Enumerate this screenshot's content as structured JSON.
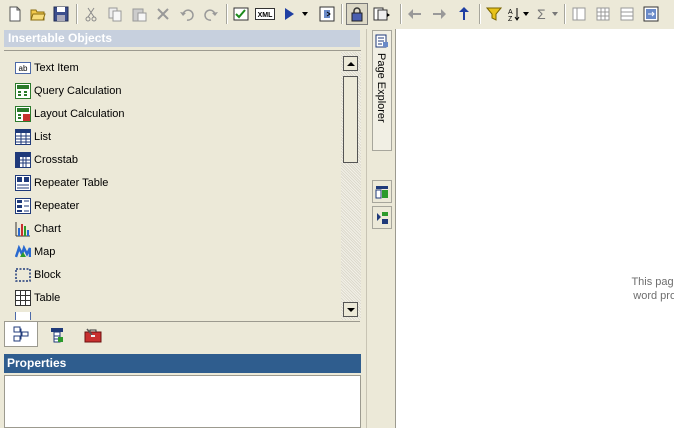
{
  "toolbar": {
    "buttons": [
      "new-icon",
      "open-icon",
      "save-icon",
      "cut-icon",
      "copy-icon",
      "paste-icon",
      "delete-icon",
      "undo-icon",
      "redo-icon",
      "validate-icon",
      "xml-icon",
      "run-icon",
      "run-dropdown-icon",
      "lock-icon",
      "pages-icon",
      "back-icon",
      "forward-icon",
      "up-icon",
      "filter-icon",
      "sort-icon",
      "summarize-icon",
      "group-icon",
      "section-icon",
      "pivot-icon",
      "swap-icon"
    ],
    "xml_label": "XML"
  },
  "insertable_objects": {
    "title": "Insertable Objects",
    "items": [
      {
        "label": "Text Item",
        "icon": "text-item-icon"
      },
      {
        "label": "Query Calculation",
        "icon": "query-calculation-icon"
      },
      {
        "label": "Layout Calculation",
        "icon": "layout-calculation-icon"
      },
      {
        "label": "List",
        "icon": "list-icon"
      },
      {
        "label": "Crosstab",
        "icon": "crosstab-icon"
      },
      {
        "label": "Repeater Table",
        "icon": "repeater-table-icon"
      },
      {
        "label": "Repeater",
        "icon": "repeater-icon"
      },
      {
        "label": "Chart",
        "icon": "chart-icon"
      },
      {
        "label": "Map",
        "icon": "map-icon"
      },
      {
        "label": "Block",
        "icon": "block-icon"
      },
      {
        "label": "Table",
        "icon": "table-icon"
      }
    ],
    "tabs": [
      "source-tab-icon",
      "data-items-tab-icon",
      "toolbox-tab-icon"
    ],
    "text_item_glyph": "ab"
  },
  "properties": {
    "title": "Properties"
  },
  "explorer": {
    "page_explorer_label": "Page Explorer"
  },
  "canvas": {
    "message_line1": "This page use",
    "message_line2": "word process"
  }
}
